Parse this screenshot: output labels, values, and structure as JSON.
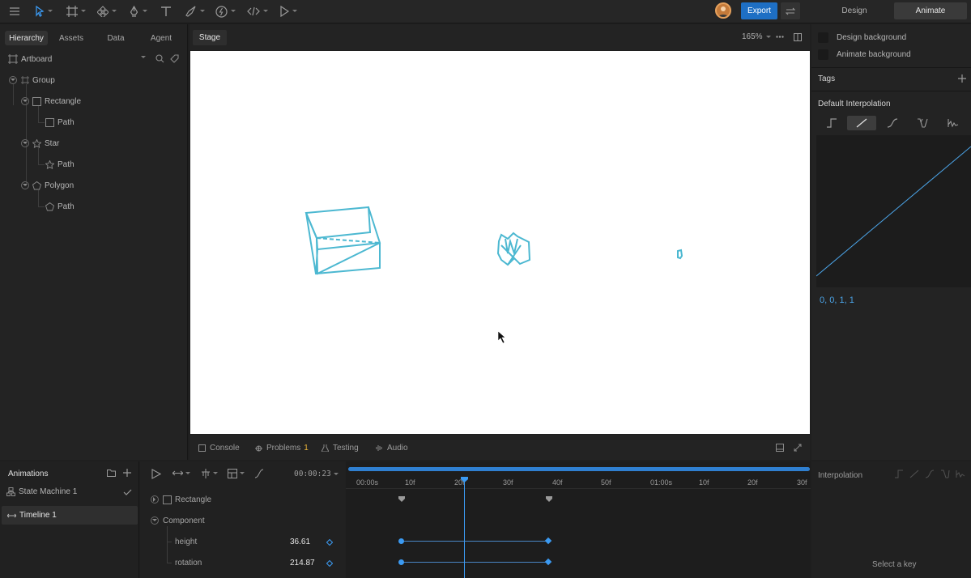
{
  "toolbar": {
    "tools": [
      "menu-icon",
      "select-icon",
      "frame-icon",
      "component-icon",
      "pen-icon",
      "text-icon",
      "brush-icon",
      "bolt-icon",
      "code-icon",
      "play-icon"
    ],
    "export_label": "Export",
    "mode_design": "Design",
    "mode_animate": "Animate"
  },
  "left_panel": {
    "tabs": [
      "Hierarchy",
      "Assets",
      "Data",
      "Agent"
    ],
    "artboard_label": "Artboard",
    "tree": [
      {
        "label": "Group",
        "icon": "group-icon"
      },
      {
        "label": "Rectangle",
        "icon": "rectangle-icon"
      },
      {
        "label": "Path",
        "icon": "rectangle-icon"
      },
      {
        "label": "Star",
        "icon": "star-icon"
      },
      {
        "label": "Path",
        "icon": "star-icon"
      },
      {
        "label": "Polygon",
        "icon": "polygon-icon"
      },
      {
        "label": "Path",
        "icon": "polygon-icon"
      }
    ]
  },
  "stage": {
    "tab_label": "Stage",
    "zoom": "165%",
    "shape_color": "#4cb8d1"
  },
  "stage_footer": {
    "console": "Console",
    "problems": "Problems",
    "problems_count": "1",
    "testing": "Testing",
    "audio": "Audio"
  },
  "right_panel": {
    "design_background": "Design background",
    "animate_background": "Animate background",
    "tags": "Tags",
    "default_interpolation": "Default Interpolation",
    "curve_values": "0, 0, 1, 1"
  },
  "animations": {
    "title": "Animations",
    "state_machine": "State Machine 1",
    "timeline": "Timeline 1"
  },
  "timeline": {
    "time_display": "00:00:23",
    "ticks": [
      "00:00s",
      "10f",
      "20f",
      "30f",
      "40f",
      "50f",
      "01:00s",
      "10f",
      "20f",
      "30f"
    ],
    "rows": {
      "rectangle": "Rectangle",
      "component": "Component",
      "height_label": "height",
      "height_value": "36.61",
      "rotation_label": "rotation",
      "rotation_value": "214.87"
    }
  },
  "interpolation_panel": {
    "title": "Interpolation",
    "hint": "Select a key"
  }
}
